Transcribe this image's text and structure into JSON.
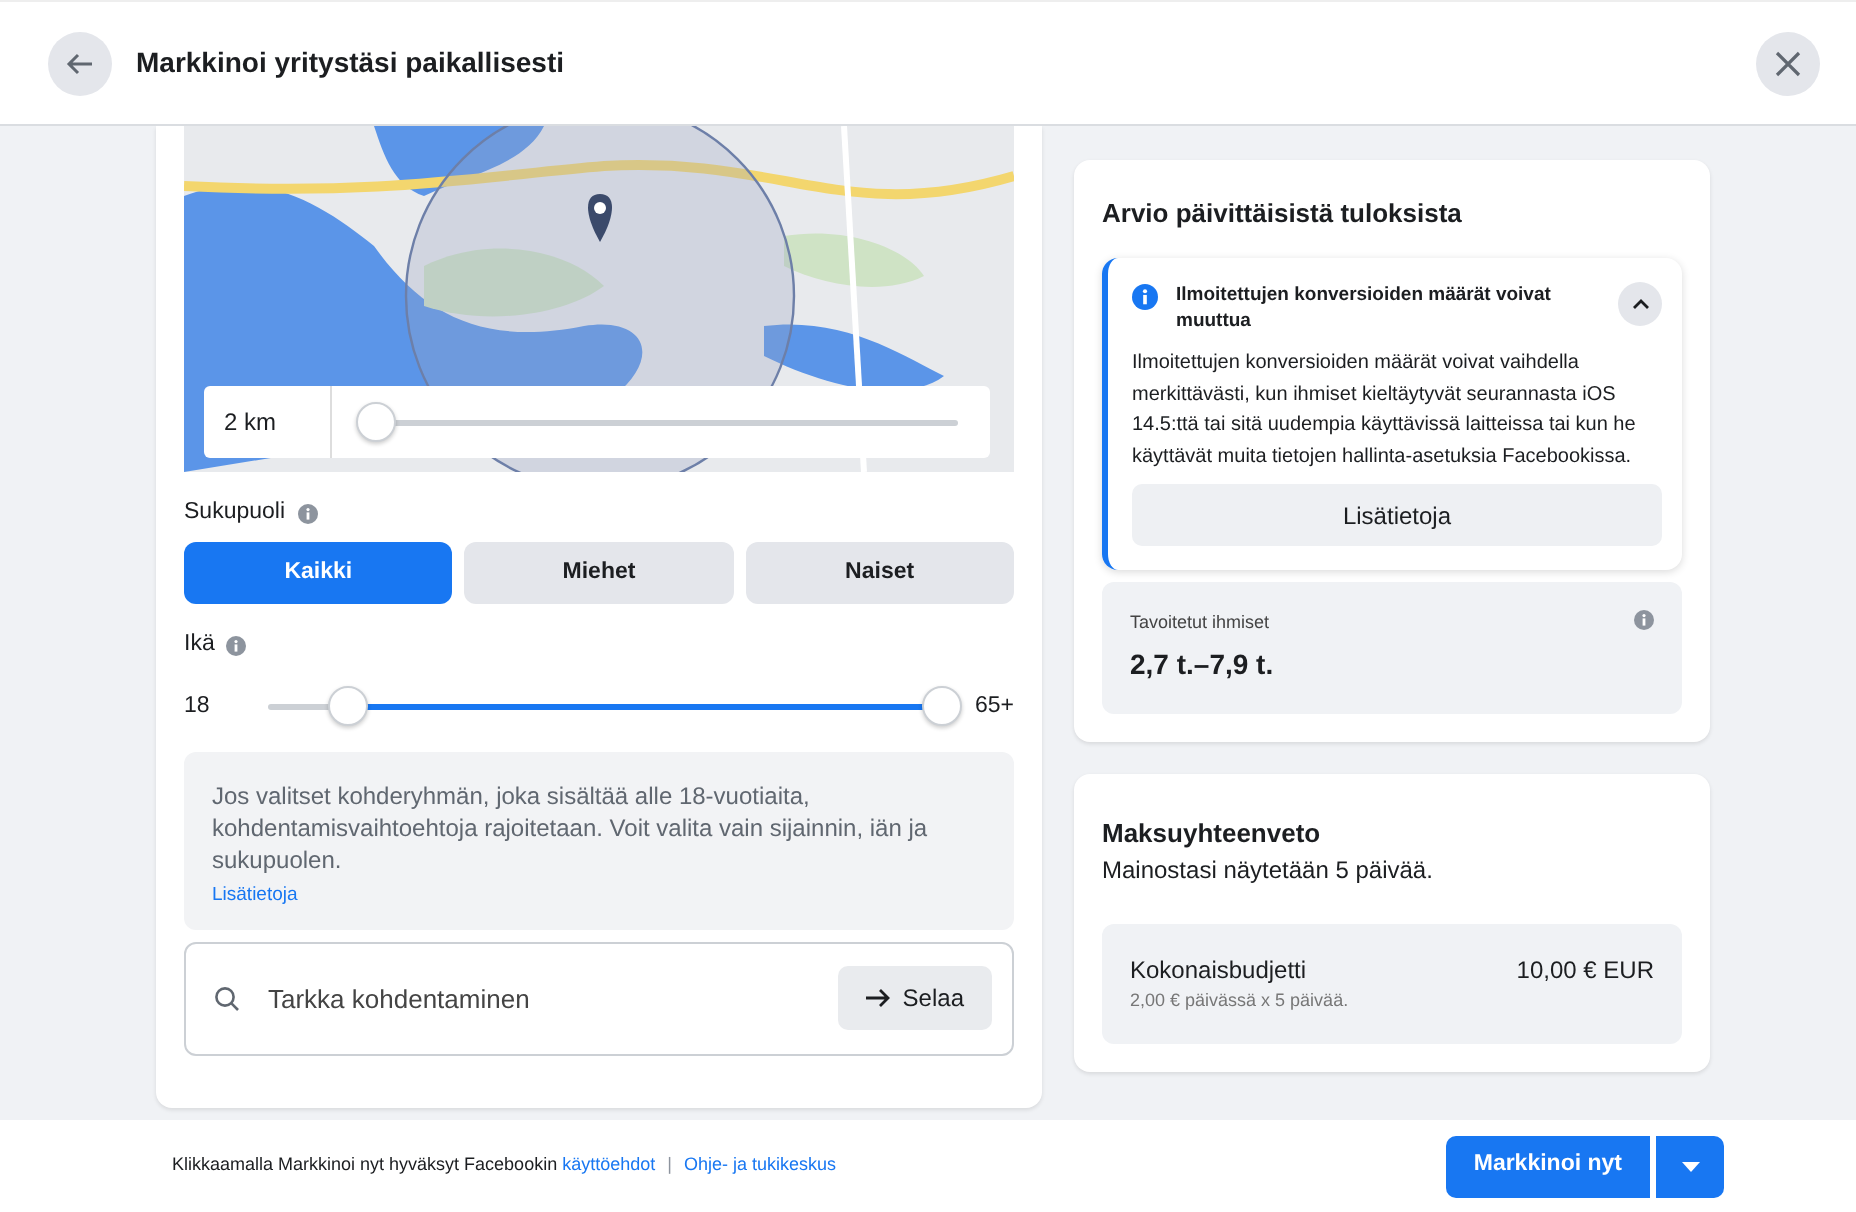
{
  "header": {
    "title": "Markkinoi yritystäsi paikallisesti"
  },
  "targeting": {
    "radius": {
      "reading": "2 km",
      "level": 0.02
    },
    "gender": {
      "label": "Sukupuoli",
      "options": [
        {
          "label": "Kaikki",
          "selected": true
        },
        {
          "label": "Miehet",
          "selected": false
        },
        {
          "label": "Naiset",
          "selected": false
        }
      ]
    },
    "age": {
      "label": "Ikä",
      "min": "18",
      "max": "65+",
      "level": 0.88
    },
    "notice": {
      "text": "Jos valitset kohderyhmän, joka sisältää alle 18-vuotiaita, kohdentamisvaihtoehtoja rajoitetaan. Voit valita vain sijainnin, iän ja sukupuolen.",
      "link": "Lisätietoja"
    },
    "search": {
      "placeholder": "Tarkka kohdentaminen",
      "button": "Selaa"
    }
  },
  "estimate": {
    "title": "Arvio päivittäisistä tuloksista",
    "alert": {
      "title": "Ilmoitettujen konversioiden määrät voivat muuttua",
      "expanded": true,
      "text": "Ilmoitettujen konversioiden määrät voivat vaihdella merkittävästi, kun ihmiset kieltäytyvät seurannasta iOS 14.5:ttä tai sitä uudempia käyttävissä laitteissa tai kun he käyttävät muita tietojen hallinta-asetuksia Facebookissa.",
      "button": "Lisätietoja"
    },
    "reach": {
      "label": "Tavoitetut ihmiset",
      "value": "2,7 t.–7,9 t."
    }
  },
  "payment": {
    "title": "Maksuyhteenveto",
    "subtitle": "Mainostasi näytetään 5 päivää.",
    "budget": {
      "label": "Kokonaisbudjetti",
      "amount": "10,00 € EUR",
      "detail": "2,00 € päivässä x 5 päivää."
    }
  },
  "footer": {
    "text": "Klikkaamalla Markkinoi nyt hyväksyt Facebookin",
    "terms_link": "käyttöehdot",
    "separator": "|",
    "help_link": "Ohje- ja tukikeskus",
    "primary_button": "Markkinoi nyt"
  }
}
